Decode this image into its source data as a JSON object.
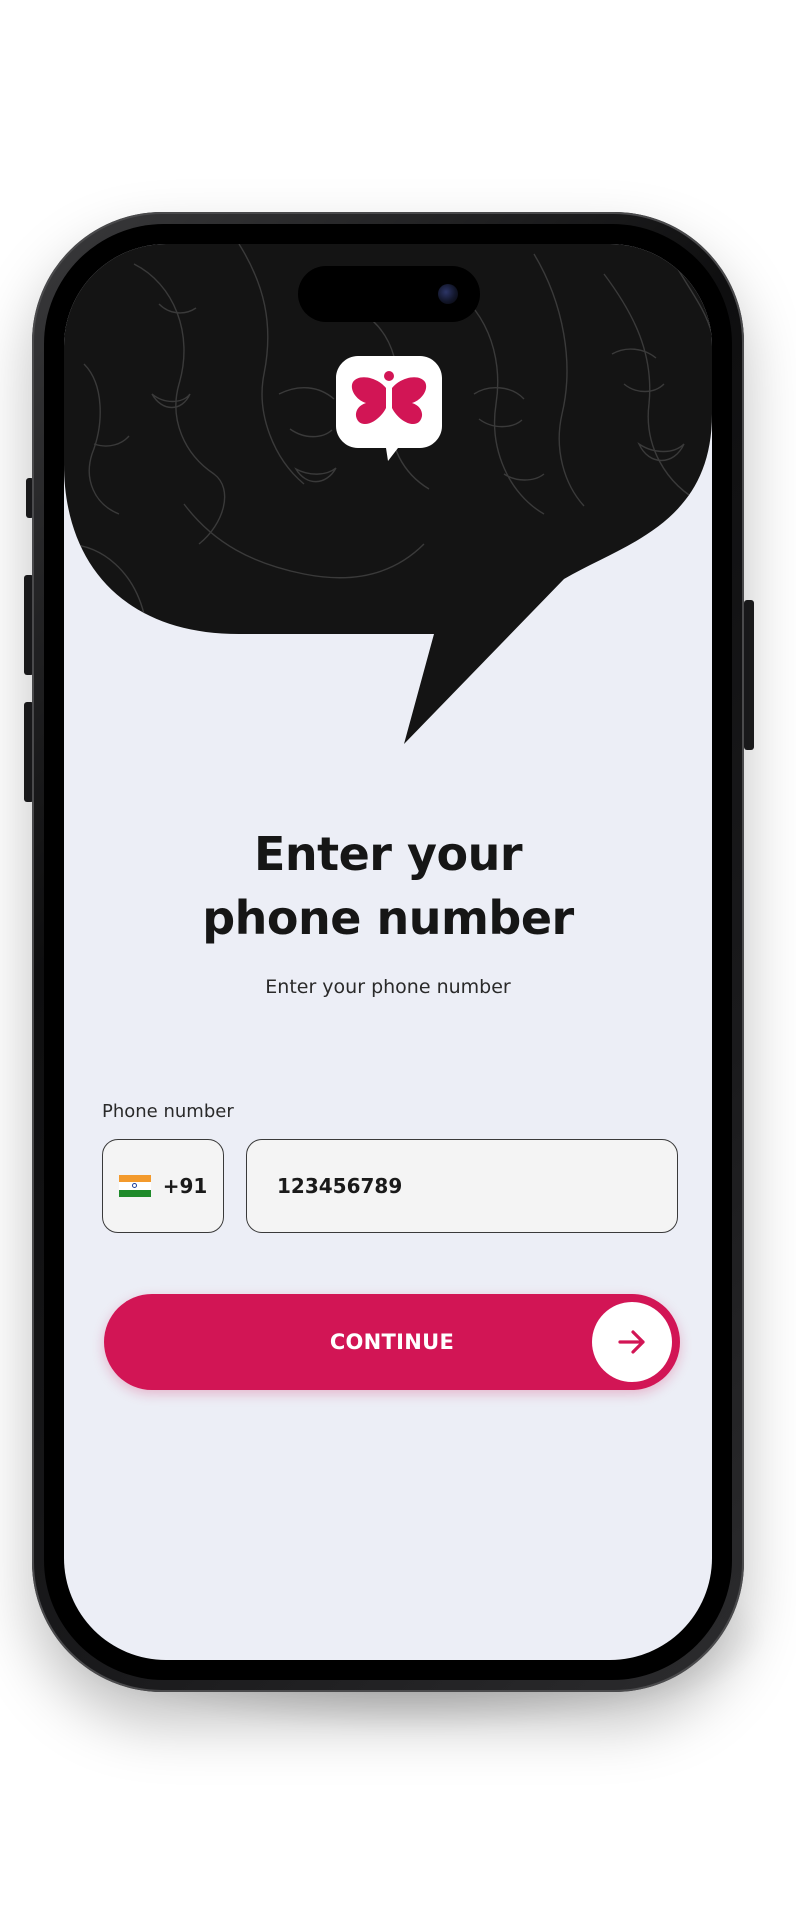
{
  "screen": {
    "title_line1": "Enter your",
    "title_line2": "phone number",
    "subtitle": "Enter your phone number"
  },
  "phone_field": {
    "label": "Phone number",
    "country_flag": "india-flag-icon",
    "country_code": "+91",
    "value": "123456789"
  },
  "continue_button": {
    "label": "CONTINUE",
    "icon": "arrow-right-icon"
  },
  "brand": {
    "logo_icon": "butterfly-chat-logo-icon",
    "accent_color": "#d21555",
    "hero_color": "#141414",
    "background_color": "#eceef6"
  }
}
